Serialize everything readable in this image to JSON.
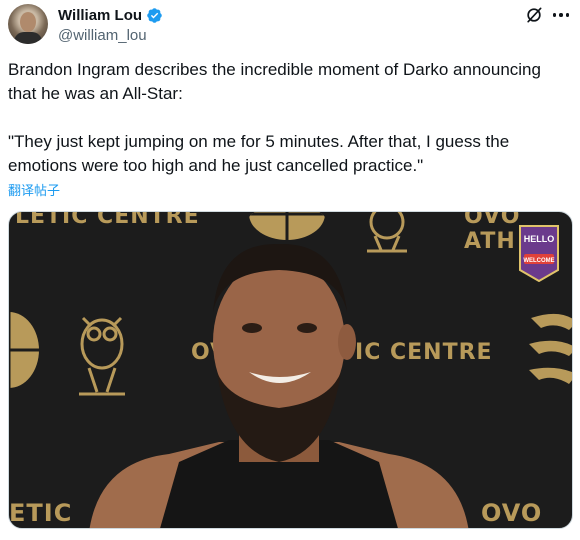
{
  "author": {
    "name": "William Lou",
    "handle": "@william_lou",
    "verified": true
  },
  "header_icons": [
    "grok-icon",
    "more-icon"
  ],
  "tweet": {
    "line1": "Brandon Ingram describes the incredible moment of Darko announcing that he was an All-Star:",
    "line2": "\"They just kept jumping on me for 5 minutes. After that, I guess the emotions were too high and he just cancelled practice.\"",
    "translate_label": "翻译帖子"
  },
  "media": {
    "wall_text_top_left": "LETIC CENTRE",
    "wall_text_top_right": "OVO ATH",
    "wall_text_middle_left": "OV",
    "wall_text_middle_right": "TIC CENTRE",
    "wall_text_bottom_left": "ETIC",
    "wall_text_bottom_right": "OVO AT",
    "badge_text_1": "HELLO",
    "badge_text_2": "WELCOME",
    "accent_color": "#b89a5a"
  },
  "colors": {
    "verified_blue": "#1d9bf0",
    "link_blue": "#1d9bf0",
    "handle_gray": "#536471",
    "text": "#0f1419"
  }
}
